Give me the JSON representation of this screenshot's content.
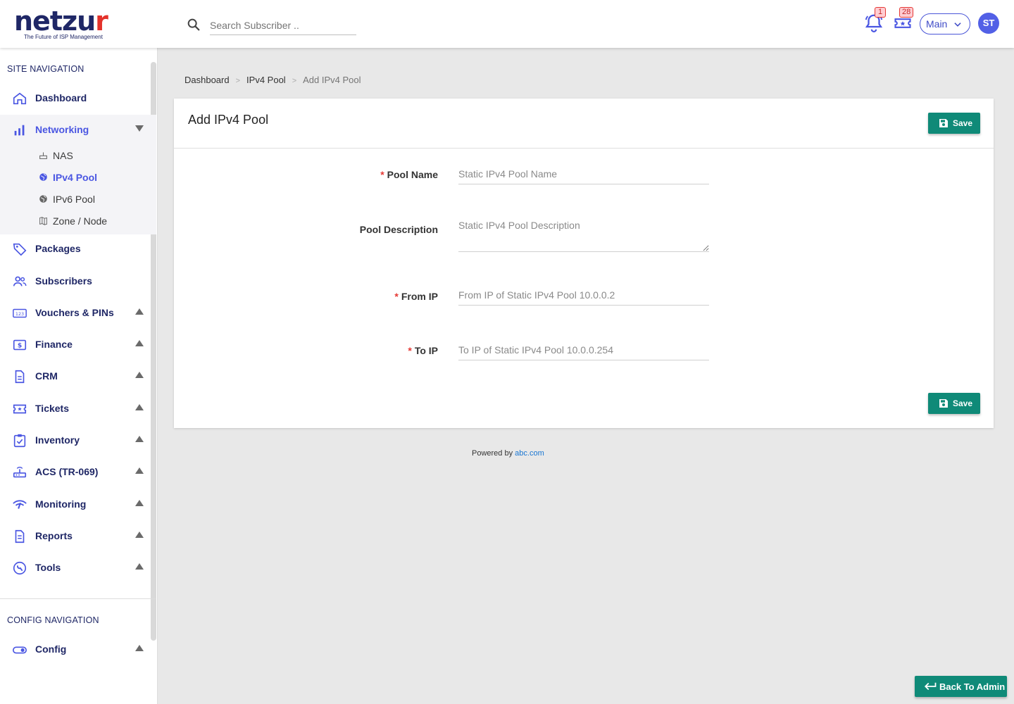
{
  "brand": {
    "name_main": "netzu",
    "name_accent": "r",
    "tagline": "The Future of ISP Management"
  },
  "header": {
    "search_placeholder": "Search Subscriber ..",
    "notifications_count": "1",
    "tickets_count": "28",
    "workspace_selected": "Main",
    "avatar_initials": "ST"
  },
  "sidebar": {
    "site_heading": "SITE NAVIGATION",
    "items": [
      {
        "label": "Dashboard",
        "icon": "home-icon"
      },
      {
        "label": "Networking",
        "icon": "bar-chart-icon",
        "expanded": true,
        "children": [
          {
            "label": "NAS",
            "icon": "router-icon"
          },
          {
            "label": "IPv4 Pool",
            "icon": "globe-icon",
            "active": true
          },
          {
            "label": "IPv6 Pool",
            "icon": "globe-icon"
          },
          {
            "label": "Zone / Node",
            "icon": "map-icon"
          }
        ]
      },
      {
        "label": "Packages",
        "icon": "tag-icon"
      },
      {
        "label": "Subscribers",
        "icon": "people-icon"
      },
      {
        "label": "Vouchers & PINs",
        "icon": "numbers-icon"
      },
      {
        "label": "Finance",
        "icon": "dollar-icon"
      },
      {
        "label": "CRM",
        "icon": "document-icon"
      },
      {
        "label": "Tickets",
        "icon": "ticket-icon"
      },
      {
        "label": "Inventory",
        "icon": "clipboard-check-icon"
      },
      {
        "label": "ACS (TR-069)",
        "icon": "router-icon"
      },
      {
        "label": "Monitoring",
        "icon": "signal-icon"
      },
      {
        "label": "Reports",
        "icon": "report-icon"
      },
      {
        "label": "Tools",
        "icon": "wrench-icon"
      }
    ],
    "config_heading": "CONFIG NAVIGATION",
    "config_items": [
      {
        "label": "Config",
        "icon": "toggle-icon"
      }
    ]
  },
  "breadcrumb": [
    "Dashboard",
    "IPv4 Pool",
    "Add IPv4 Pool"
  ],
  "form": {
    "title": "Add IPv4 Pool",
    "save_label": "Save",
    "required_marker": "*",
    "fields": [
      {
        "label": "Pool Name",
        "required": true,
        "placeholder": "Static IPv4 Pool Name",
        "value": ""
      },
      {
        "label": "Pool Description",
        "required": false,
        "placeholder": "Static IPv4 Pool Description",
        "value": ""
      },
      {
        "label": "From IP",
        "required": true,
        "placeholder": "From IP of Static IPv4 Pool 10.0.0.2",
        "value": ""
      },
      {
        "label": "To IP",
        "required": true,
        "placeholder": "To IP of Static IPv4 Pool 10.0.0.254",
        "value": ""
      }
    ]
  },
  "footer": {
    "prefix": "Powered by",
    "link": "abc.com"
  },
  "back_button": "Back To Admin",
  "colors": {
    "primary": "#4a56e2",
    "navy": "#1f2766",
    "save": "#0f8a78",
    "required": "#e53935"
  }
}
